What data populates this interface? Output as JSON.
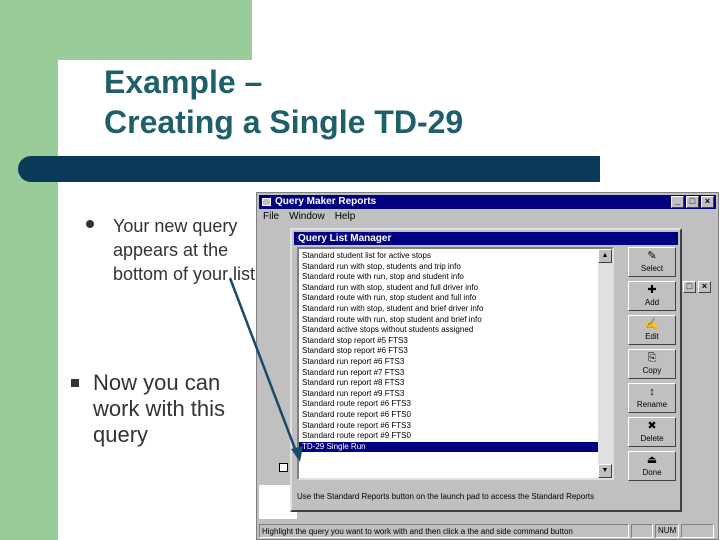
{
  "slide": {
    "title_line1": "Example –",
    "title_line2": "Creating a Single TD-29",
    "bullet1": "Your new query appears at the bottom of your list",
    "bullet2": "Now you can work with this query"
  },
  "colors": {
    "green": "#99cc99",
    "dark_blue_bar": "#0b3a5a",
    "title_text": "#1f5f6b",
    "win_title": "#000080",
    "arrow": "#1a4a6a"
  },
  "app_window": {
    "title": "Query Maker Reports",
    "menu": [
      "File",
      "Window",
      "Help"
    ],
    "statusbar_text": "Highlight the query you want to work with and then click a the and side command button",
    "num_indicator": "NUM"
  },
  "dialog": {
    "title": "Query List Manager",
    "items": [
      "Standard student list for active stops",
      "Standard run with stop, students and trip info",
      "Standard route with run, stop and student info",
      "Standard run with stop, student and full driver info",
      "Standard route with run, stop student and full info",
      "Standard run with stop, student and brief driver info",
      "Standard route with run, stop student and brief info",
      "Standard active stops without students assigned",
      "Standard stop report #5 FTS3",
      "Standard stop report #6 FTS3",
      "Standard run report #6 FTS3",
      "Standard run report #7 FTS3",
      "Standard run report #8 FTS3",
      "Standard run report #9 FTS3",
      "Standard route report #6 FTS3",
      "Standard route report #6 FTS0",
      "Standard route report #6 FTS3",
      "Standard route report #9 FTS0",
      "TD-29 Single Run"
    ],
    "selected_index": 18,
    "buttons": [
      {
        "label": "Select",
        "icon": "✎"
      },
      {
        "label": "Add",
        "icon": "✚"
      },
      {
        "label": "Edit",
        "icon": "✍"
      },
      {
        "label": "Copy",
        "icon": "⎘"
      },
      {
        "label": "Rename",
        "icon": "↕"
      },
      {
        "label": "Delete",
        "icon": "✖"
      },
      {
        "label": "Done",
        "icon": "⏏"
      }
    ],
    "status_message": "Use the Standard Reports button on the launch pad to access the Standard Reports"
  }
}
